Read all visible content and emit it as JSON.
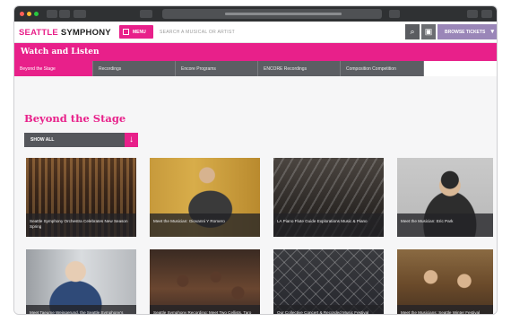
{
  "site": {
    "logo_part1": "SEATTLE",
    "logo_part2": "SYMPHONY",
    "menu_label": "MENU",
    "search_placeholder": "SEARCH A MUSICAL OR ARTIST",
    "tickets_label": "BROWSE TICKETS",
    "accent_color": "#e8208a",
    "tickets_color": "#9a86b8"
  },
  "section": {
    "title": "Watch and Listen"
  },
  "tabs": [
    {
      "label": "Beyond the Stage",
      "active": true
    },
    {
      "label": "Recordings",
      "active": false
    },
    {
      "label": "Encore Programs",
      "active": false
    },
    {
      "label": "ENCORE Recordings",
      "active": false
    },
    {
      "label": "Composition Competition",
      "active": false
    }
  ],
  "main": {
    "page_title": "Beyond the Stage",
    "show_all_label": "SHOW ALL"
  },
  "cards": [
    {
      "caption": "Seattle Symphony Orchestra Celebrates New Season Spring"
    },
    {
      "caption": "Meet the Musician: Giovanni Y Romero"
    },
    {
      "caption": "LA Piano Flute Guide Explorations Music & Piano"
    },
    {
      "caption": "Meet the Musician: Eric Park"
    },
    {
      "caption": "Meet Taeume Weingerund, the Seattle Symphony's New Music Director"
    },
    {
      "caption": "Seattle Symphony Recording: Meet Two Cellists, Taro Ho"
    },
    {
      "caption": "Our Collective Concert & Recorded Music Festival"
    },
    {
      "caption": "Meet the Musicians: Seattle Winter Festival"
    }
  ]
}
